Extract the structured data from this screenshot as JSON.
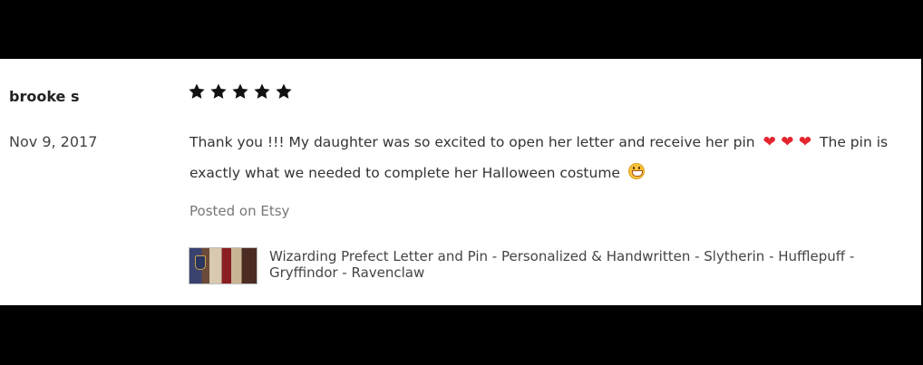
{
  "review": {
    "reviewer": "brooke s",
    "date": "Nov 9, 2017",
    "rating": 5,
    "rating_max": 5,
    "text_part1": "Thank you !!! My daughter was so excited to open her letter and receive her pin",
    "hearts": "❤ ❤ ❤",
    "text_part2": "The pin is exactly what we needed to complete her Halloween costume",
    "source": "Posted on Etsy",
    "listing_title": "Wizarding Prefect Letter and Pin - Personalized & Handwritten - Slytherin - Hufflepuff - Gryffindor - Ravenclaw"
  },
  "icons": {
    "star": "star-icon",
    "heart": "heart-icon",
    "emoji": "grinning-face-icon"
  },
  "colors": {
    "star": "#111111",
    "heart": "#e3262e",
    "background_bars": "#000000"
  }
}
